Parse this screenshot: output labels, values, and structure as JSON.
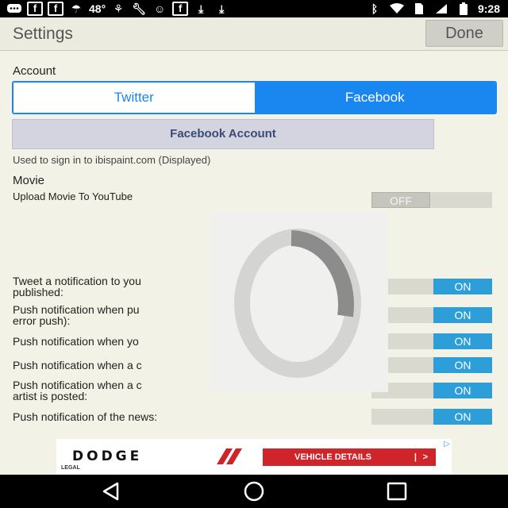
{
  "status_bar": {
    "temperature": "48°",
    "time": "9:28",
    "left_icons": [
      "chat-icon",
      "facebook-icon",
      "facebook-icon",
      "weather-icon",
      "cycling-icon",
      "wrench-icon",
      "gamepad-icon",
      "facebook-icon",
      "download-icon",
      "download-icon"
    ],
    "right_icons": [
      "bluetooth-icon",
      "wifi-icon",
      "sim-icon",
      "signal-icon",
      "battery-icon"
    ]
  },
  "header": {
    "title": "Settings",
    "done_label": "Done"
  },
  "account": {
    "section_label": "Account",
    "tabs": [
      {
        "label": "Twitter",
        "selected": false
      },
      {
        "label": "Facebook",
        "selected": true
      }
    ],
    "facebook_account_button": "Facebook Account",
    "helper_text": "Used to sign in to ibispaint.com (Displayed)"
  },
  "movie": {
    "section_label": "Movie",
    "upload_label": "Upload Movie To YouTube",
    "upload_toggle": "OFF"
  },
  "notifications": [
    {
      "line1": "Tweet a notification to you",
      "line2": "published:",
      "state": "ON"
    },
    {
      "line1": "Push notification when pu",
      "line2": "error push):",
      "state": "ON"
    },
    {
      "line1": "Push notification when yo",
      "line2": "",
      "state": "ON"
    },
    {
      "line1": "Push notification when a c",
      "line2": "",
      "state": "ON"
    },
    {
      "line1": "Push notification when a c",
      "line2": "artist is posted:",
      "state": "ON"
    },
    {
      "line1": "Push notification of the news:",
      "line2": "",
      "state": "ON"
    }
  ],
  "ad": {
    "brand": "DODGE",
    "cta": "VEHICLE DETAILS",
    "cta_sep": "|",
    "cta_arrow": ">",
    "legal": "LEGAL"
  },
  "colors": {
    "accent_blue": "#1a86f0",
    "switch_on": "#2e9ed8",
    "ad_red": "#d0242b",
    "background": "#f3f2e6"
  }
}
